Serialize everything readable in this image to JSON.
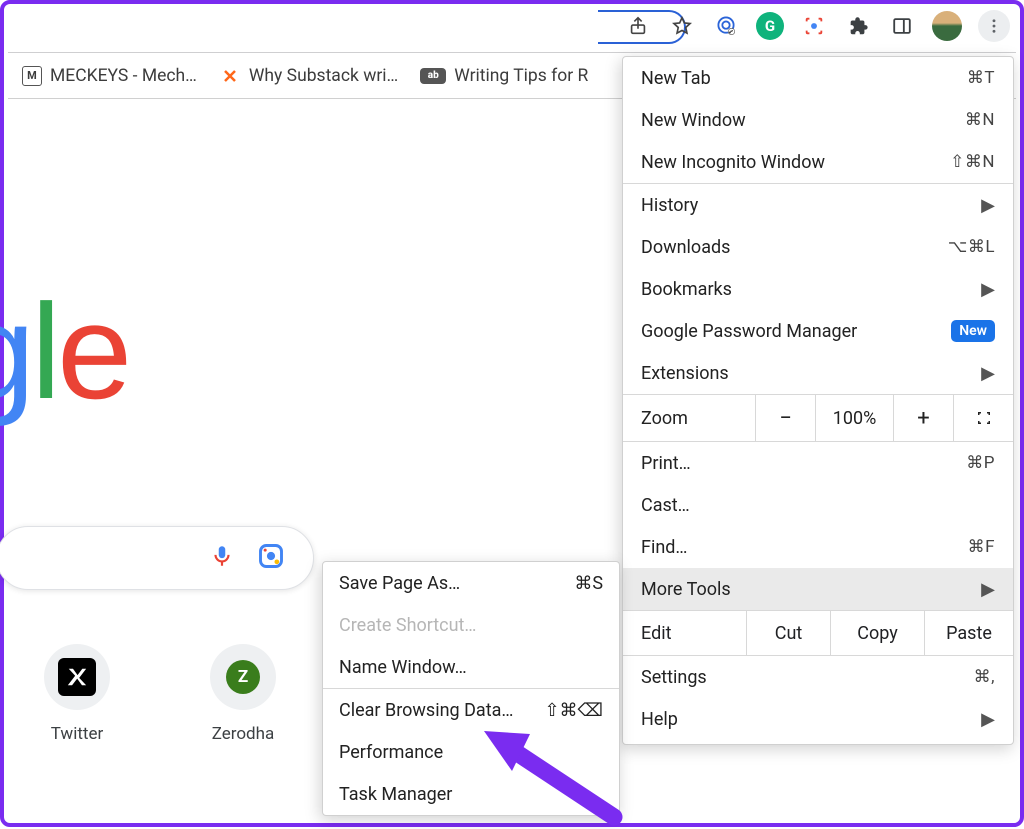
{
  "toolbar": {
    "grammarly_letter": "G"
  },
  "bookmarks": [
    {
      "icon_letter": "M",
      "label": "MECKEYS - Mech…"
    },
    {
      "icon_letter": "<>",
      "label": "Why Substack wri…"
    },
    {
      "icon_letter": "ab",
      "label": "Writing Tips for R"
    }
  ],
  "logo_letters": {
    "g": "g",
    "l": "l",
    "e": "e"
  },
  "shortcuts": [
    {
      "id": "twitter",
      "label": "Twitter"
    },
    {
      "id": "zerodha",
      "label": "Zerodha",
      "letter": "Z"
    }
  ],
  "menu": {
    "new_tab": "New Tab",
    "new_tab_sc": "⌘T",
    "new_window": "New Window",
    "new_window_sc": "⌘N",
    "new_incognito": "New Incognito Window",
    "new_incognito_sc": "⇧⌘N",
    "history": "History",
    "downloads": "Downloads",
    "downloads_sc": "⌥⌘L",
    "bookmarks": "Bookmarks",
    "gpm": "Google Password Manager",
    "gpm_badge": "New",
    "extensions": "Extensions",
    "zoom_label": "Zoom",
    "zoom_minus": "−",
    "zoom_val": "100%",
    "zoom_plus": "+",
    "print": "Print…",
    "print_sc": "⌘P",
    "cast": "Cast…",
    "find": "Find…",
    "find_sc": "⌘F",
    "more_tools": "More Tools",
    "edit_label": "Edit",
    "cut": "Cut",
    "copy": "Copy",
    "paste": "Paste",
    "settings": "Settings",
    "settings_sc": "⌘,",
    "help": "Help"
  },
  "submenu": {
    "save_page": "Save Page As…",
    "save_page_sc": "⌘S",
    "create_shortcut": "Create Shortcut…",
    "name_window": "Name Window…",
    "clear_browsing": "Clear Browsing Data…",
    "clear_browsing_sc": "⇧⌘⌫",
    "performance": "Performance",
    "task_manager": "Task Manager"
  }
}
